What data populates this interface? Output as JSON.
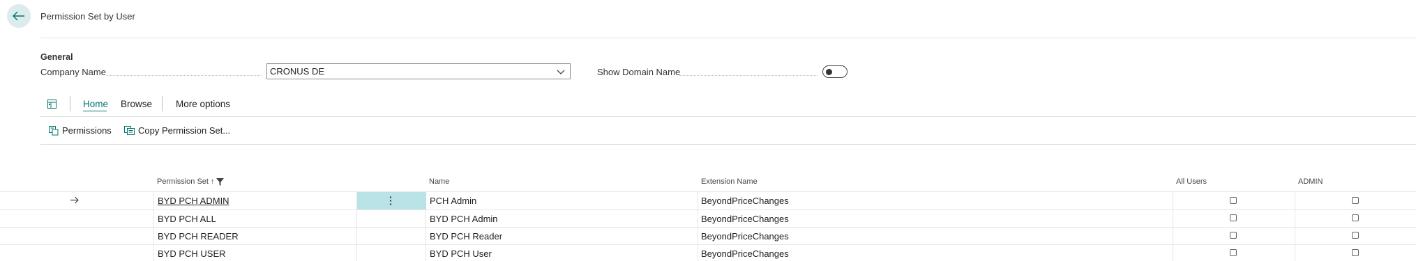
{
  "header": {
    "title": "Permission Set by User"
  },
  "general": {
    "group_title": "General",
    "company_label": "Company Name",
    "company_value": "CRONUS DE",
    "domain_label": "Show Domain Name"
  },
  "tabs": [
    "Home",
    "Browse",
    "More options"
  ],
  "actions": {
    "permissions": "Permissions",
    "copy": "Copy Permission Set..."
  },
  "columns": {
    "permission_set": "Permission Set",
    "sort_indicator": "↑",
    "name": "Name",
    "extension": "Extension Name",
    "all_users": "All Users",
    "admin": "ADMIN"
  },
  "rows": [
    {
      "permission_set": "BYD PCH ADMIN",
      "name": "PCH Admin",
      "extension": "BeyondPriceChanges"
    },
    {
      "permission_set": "BYD PCH ALL",
      "name": "BYD PCH Admin",
      "extension": "BeyondPriceChanges"
    },
    {
      "permission_set": "BYD PCH READER",
      "name": "BYD PCH Reader",
      "extension": "BeyondPriceChanges"
    },
    {
      "permission_set": "BYD PCH USER",
      "name": "BYD PCH User",
      "extension": "BeyondPriceChanges"
    }
  ],
  "colors": {
    "accent": "#00756f",
    "selected_cell": "#b9e3e6",
    "back_button_bg": "#dcebeb"
  },
  "icons": [
    "back-arrow-icon",
    "chevron-down-icon",
    "filter-icon",
    "layout-icon",
    "permissions-icon",
    "copy-icon",
    "row-arrow-icon",
    "more-vertical-icon"
  ]
}
